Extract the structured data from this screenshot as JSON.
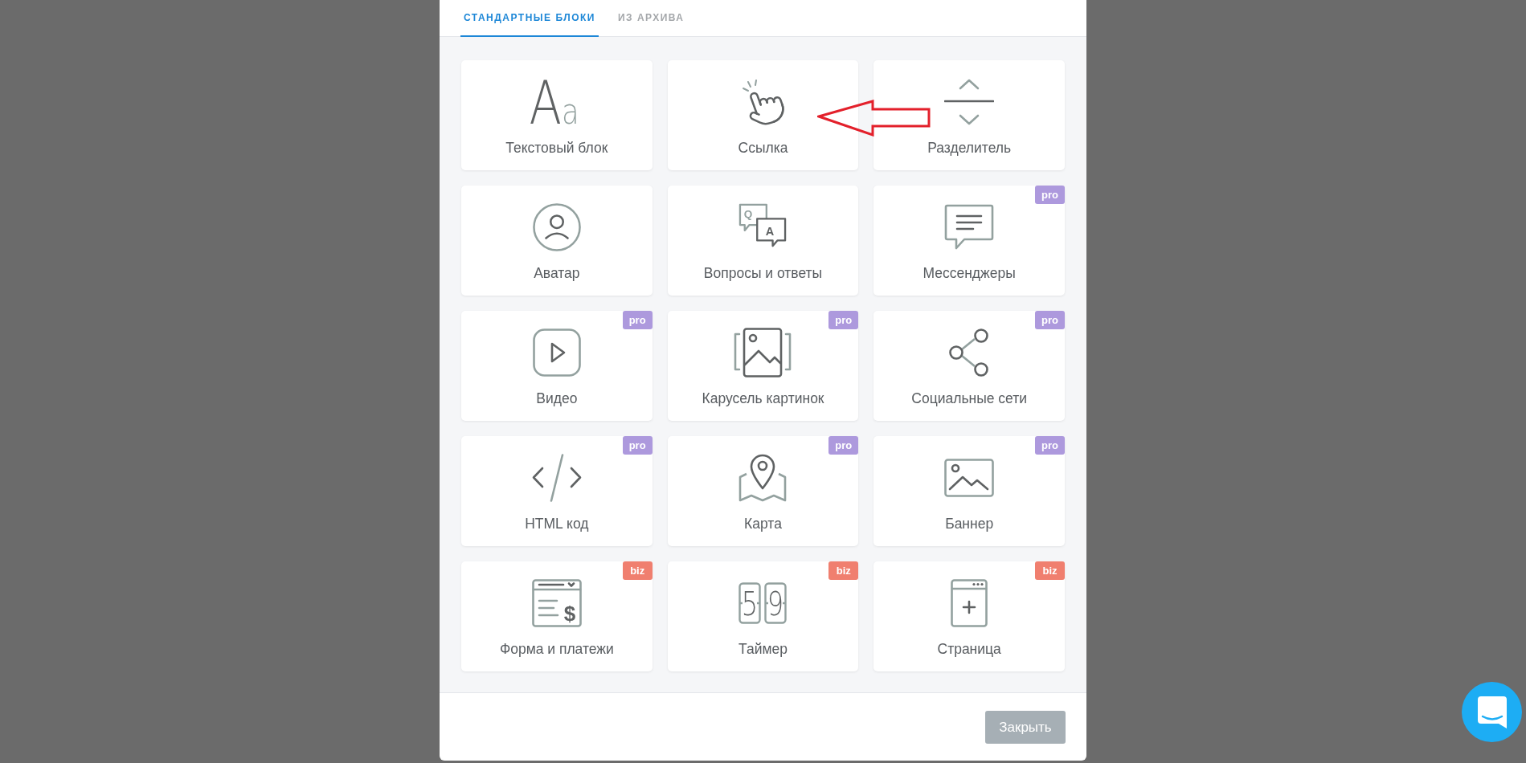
{
  "tabs": [
    {
      "label": "СТАНДАРТНЫЕ БЛОКИ",
      "selected": true
    },
    {
      "label": "ИЗ АРХИВА",
      "selected": false
    }
  ],
  "blocks": [
    {
      "label": "Текстовый блок",
      "icon_text": [
        "A",
        "a"
      ]
    },
    {
      "label": "Ссылка"
    },
    {
      "label": "Разделитель"
    },
    {
      "label": "Аватар"
    },
    {
      "label": "Вопросы и ответы",
      "icon_text": [
        "Q",
        "A"
      ]
    },
    {
      "label": "Мессенджеры",
      "badge": {
        "text": "pro",
        "color": "#ad99dd"
      }
    },
    {
      "label": "Видео",
      "badge": {
        "text": "pro",
        "color": "#ad99dd"
      }
    },
    {
      "label": "Карусель картинок",
      "badge": {
        "text": "pro",
        "color": "#ad99dd"
      }
    },
    {
      "label": "Социальные сети",
      "badge": {
        "text": "pro",
        "color": "#ad99dd"
      }
    },
    {
      "label": "HTML код",
      "badge": {
        "text": "pro",
        "color": "#ad99dd"
      }
    },
    {
      "label": "Карта",
      "badge": {
        "text": "pro",
        "color": "#ad99dd"
      }
    },
    {
      "label": "Баннер",
      "badge": {
        "text": "pro",
        "color": "#ad99dd"
      }
    },
    {
      "label": "Форма и платежи",
      "icon_text": [
        "$"
      ],
      "badge": {
        "text": "biz",
        "color": "#f07f6f"
      }
    },
    {
      "label": "Таймер",
      "icon_text": [
        "5",
        "9"
      ],
      "badge": {
        "text": "biz",
        "color": "#f07f6f"
      }
    },
    {
      "label": "Страница",
      "badge": {
        "text": "biz",
        "color": "#f07f6f"
      }
    }
  ],
  "close_button": "Закрыть"
}
